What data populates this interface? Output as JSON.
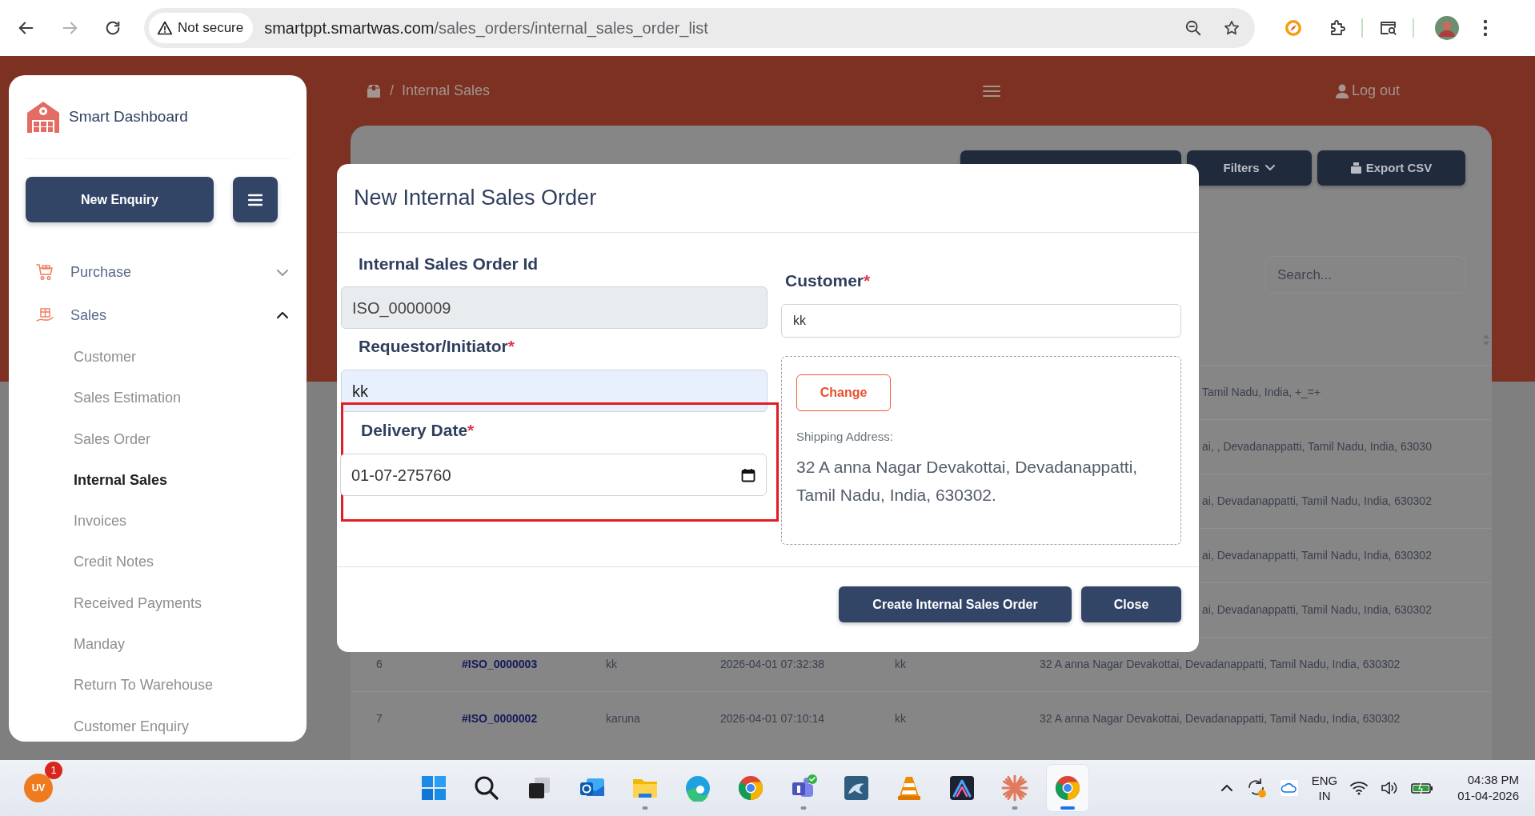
{
  "browser": {
    "back": {
      "disabled": false
    },
    "forward": {
      "disabled": true
    },
    "security": "Not secure",
    "url_host": "smartppt.smartwas.com",
    "url_path": "/sales_orders/internal_sales_order_list"
  },
  "sidebar": {
    "brand": "Smart Dashboard",
    "new_button": "New Enquiry",
    "menu": [
      {
        "label": "Purchase",
        "kind": "cart",
        "expanded": false
      },
      {
        "label": "Sales",
        "kind": "gift",
        "expanded": true,
        "children": [
          {
            "label": "Customer",
            "selected": false
          },
          {
            "label": "Sales Estimation",
            "selected": false
          },
          {
            "label": "Sales Order",
            "selected": false
          },
          {
            "label": "Internal Sales",
            "selected": true
          },
          {
            "label": "Invoices",
            "selected": false
          },
          {
            "label": "Credit Notes",
            "selected": false
          },
          {
            "label": "Received Payments",
            "selected": false
          },
          {
            "label": "Manday",
            "selected": false
          },
          {
            "label": "Return To Warehouse",
            "selected": false
          },
          {
            "label": "Customer Enquiry",
            "selected": false
          }
        ]
      }
    ]
  },
  "topbar": {
    "separator": "/",
    "breadcrumb": "Internal Sales",
    "logout": "Log out"
  },
  "page": {
    "buttons": [
      {
        "kind": "blank"
      },
      {
        "kind": "dropdown",
        "label": "Filters"
      },
      {
        "kind": "export",
        "label": "Export CSV"
      }
    ],
    "search": {
      "placeholder": "Search..."
    },
    "rows": [
      {
        "kind": "partial",
        "address": "Tamil Nadu, India, +_=+"
      },
      {
        "kind": "partial",
        "address": "ai, , Devadanappatti, Tamil Nadu, India, 63030"
      },
      {
        "kind": "partial",
        "address": "ai, Devadanappatti, Tamil Nadu, India, 630302"
      },
      {
        "kind": "partial",
        "address": "ai, Devadanappatti, Tamil Nadu, India, 630302"
      },
      {
        "kind": "partial",
        "address": "ai, Devadanappatti, Tamil Nadu, India, 630302"
      },
      {
        "kind": "full",
        "cells": [
          "6",
          "#ISO_0000003",
          "kk",
          "2026-04-01 07:32:38",
          "kk",
          "32 A anna Nagar Devakottai, Devadanappatti, Tamil Nadu, India, 630302"
        ]
      },
      {
        "kind": "full",
        "cells": [
          "7",
          "#ISO_0000002",
          "karuna",
          "2026-04-01 07:10:14",
          "kk",
          "32 A anna Nagar Devakottai, Devadanappatti, Tamil Nadu, India, 630302"
        ]
      }
    ]
  },
  "modal": {
    "title": "New Internal Sales Order",
    "fields": [
      {
        "label": "Internal Sales Order Id",
        "value": "ISO_0000009",
        "kind": "readonly"
      },
      {
        "label": "Requestor/Initiator",
        "required_mark": "*",
        "value": "kk",
        "kind": "autofill"
      },
      {
        "label": "Delivery Date",
        "required_mark": "*",
        "value": "01-07-275760",
        "kind": "date",
        "highlighted": true
      }
    ],
    "customer": {
      "label": "Customer",
      "required_mark": "*",
      "value": "kk"
    },
    "shipping": {
      "button": "Change",
      "label": "Shipping Address:",
      "address": "32 A anna Nagar Devakottai, Devadanappatti, Tamil Nadu, India, 630302."
    },
    "buttons": [
      "Create Internal Sales Order",
      "Close"
    ]
  },
  "taskbar": {
    "avatar": "UV",
    "badge": "1",
    "apps": [
      {
        "kind": "start",
        "running": false,
        "selected": false
      },
      {
        "kind": "search",
        "running": false,
        "selected": false
      },
      {
        "kind": "taskview",
        "running": false,
        "selected": false
      },
      {
        "kind": "mail",
        "running": false,
        "selected": false
      },
      {
        "kind": "folder",
        "running": true,
        "selected": false
      },
      {
        "kind": "edge",
        "running": false,
        "selected": false
      },
      {
        "kind": "chrome",
        "running": false,
        "selected": false
      },
      {
        "kind": "teams",
        "running": true,
        "selected": false
      },
      {
        "kind": "dolphin",
        "running": false,
        "selected": false
      },
      {
        "kind": "cone",
        "running": false,
        "selected": false
      },
      {
        "kind": "peak",
        "running": false,
        "selected": false
      },
      {
        "kind": "burst",
        "running": true,
        "selected": false
      },
      {
        "kind": "chrome",
        "running": true,
        "selected": true
      }
    ],
    "language": "ENG",
    "region": "IN",
    "time": "04:38 PM",
    "date": "01-04-2026"
  }
}
